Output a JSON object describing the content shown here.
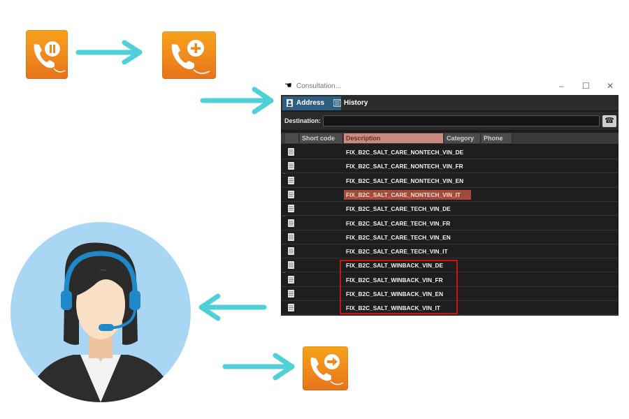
{
  "window": {
    "title": "Consultation...",
    "controls": [
      "–",
      "☐",
      "✕"
    ],
    "tabs": [
      {
        "label": "Address book",
        "icon": "address-book-icon",
        "active": true
      },
      {
        "label": "History",
        "icon": "history-icon",
        "active": false
      }
    ],
    "destination_label": "Destination:",
    "destination_value": "",
    "call_button_icon": "phone-icon",
    "columns": [
      "Short code",
      "Description",
      "Category",
      "Phone"
    ],
    "rows": [
      {
        "description": "FIX_B2C_SALT_CARE_NONTECH_VIN_DE",
        "selected": false
      },
      {
        "description": "FIX_B2C_SALT_CARE_NONTECH_VIN_FR",
        "selected": false
      },
      {
        "description": "FIX_B2C_SALT_CARE_NONTECH_VIN_EN",
        "selected": false
      },
      {
        "description": "FIX_B2C_SALT_CARE_NONTECH_VIN_IT",
        "selected": true
      },
      {
        "description": "FIX_B2C_SALT_CARE_TECH_VIN_DE",
        "selected": false
      },
      {
        "description": "FIX_B2C_SALT_CARE_TECH_VIN_FR",
        "selected": false
      },
      {
        "description": "FIX_B2C_SALT_CARE_TECH_VIN_EN",
        "selected": false
      },
      {
        "description": "FIX_B2C_SALT_CARE_TECH_VIN_IT",
        "selected": false
      },
      {
        "description": "FIX_B2C_SALT_WINBACK_VIN_DE",
        "selected": false
      },
      {
        "description": "FIX_B2C_SALT_WINBACK_VIN_FR",
        "selected": false
      },
      {
        "description": "FIX_B2C_SALT_WINBACK_VIN_EN",
        "selected": false
      },
      {
        "description": "FIX_B2C_SALT_WINBACK_VIN_IT",
        "selected": false
      }
    ]
  },
  "icons": {
    "hold": "phone-pause-icon",
    "add": "phone-add-icon",
    "transfer": "phone-transfer-icon",
    "agent": "call-center-agent-avatar"
  },
  "colors": {
    "accent_orange": "#f0891c",
    "arrow_teal": "#4fcfd8",
    "highlight_red": "#d40f0f",
    "selected_row": "#a24b3c"
  }
}
